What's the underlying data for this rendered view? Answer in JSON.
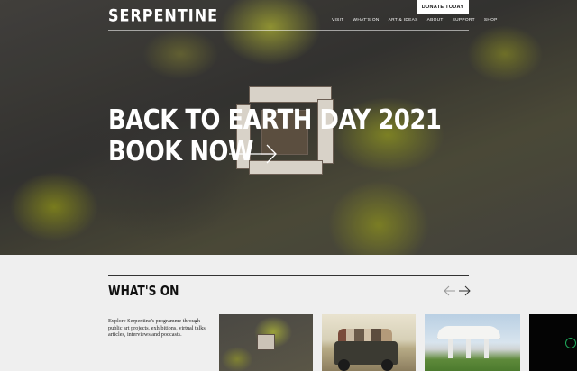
{
  "header": {
    "logo_text": "SERPENTINE",
    "donate_label": "DONATE TODAY",
    "nav": [
      "VISIT",
      "WHAT'S ON",
      "ART & IDEAS",
      "ABOUT",
      "SUPPORT",
      "SHOP"
    ]
  },
  "hero": {
    "headline_line1": "BACK TO EARTH DAY 2021",
    "headline_line2": "BOOK NOW",
    "arrow_icon": "arrow-right-icon"
  },
  "whats_on": {
    "title": "WHAT'S ON",
    "intro": "Explore Serpentine's programme through public art projects, exhibitions, virtual talks, articles, interviews and podcasts.",
    "prev_icon": "arrow-left-icon",
    "next_icon": "arrow-right-icon"
  },
  "colors": {
    "background": "#efefef",
    "text": "#111111",
    "hero_text": "#ffffff",
    "card4_accent": "#1fa85a"
  }
}
